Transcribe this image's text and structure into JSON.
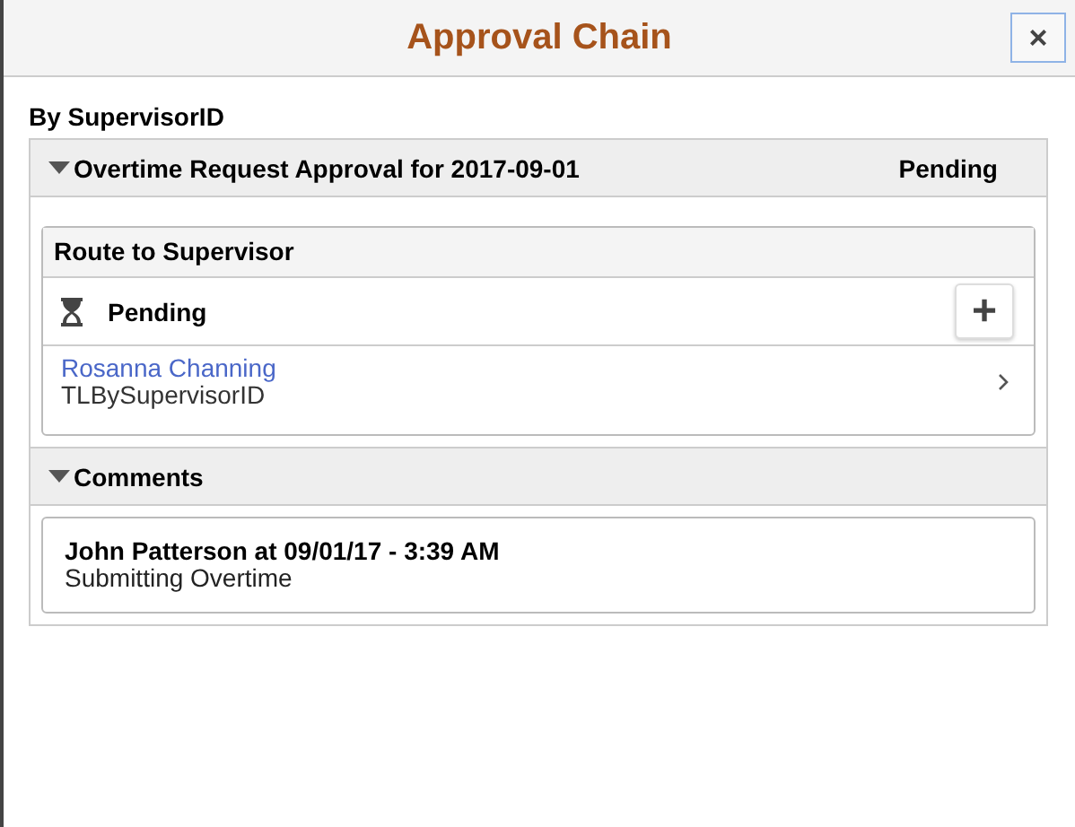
{
  "dialog": {
    "title": "Approval Chain",
    "close_label": "×"
  },
  "group_label": "By SupervisorID",
  "approval": {
    "title": "Overtime Request Approval for 2017-09-01",
    "status": "Pending",
    "expanded": true,
    "step": {
      "title": "Route to Supervisor",
      "status": "Pending",
      "add_label": "+",
      "approver": {
        "name": "Rosanna Channing",
        "role": "TLBySupervisorID"
      }
    }
  },
  "comments": {
    "title": "Comments",
    "expanded": true,
    "items": [
      {
        "header": "John Patterson at 09/01/17 - 3:39 AM",
        "text": "Submitting Overtime"
      }
    ]
  }
}
